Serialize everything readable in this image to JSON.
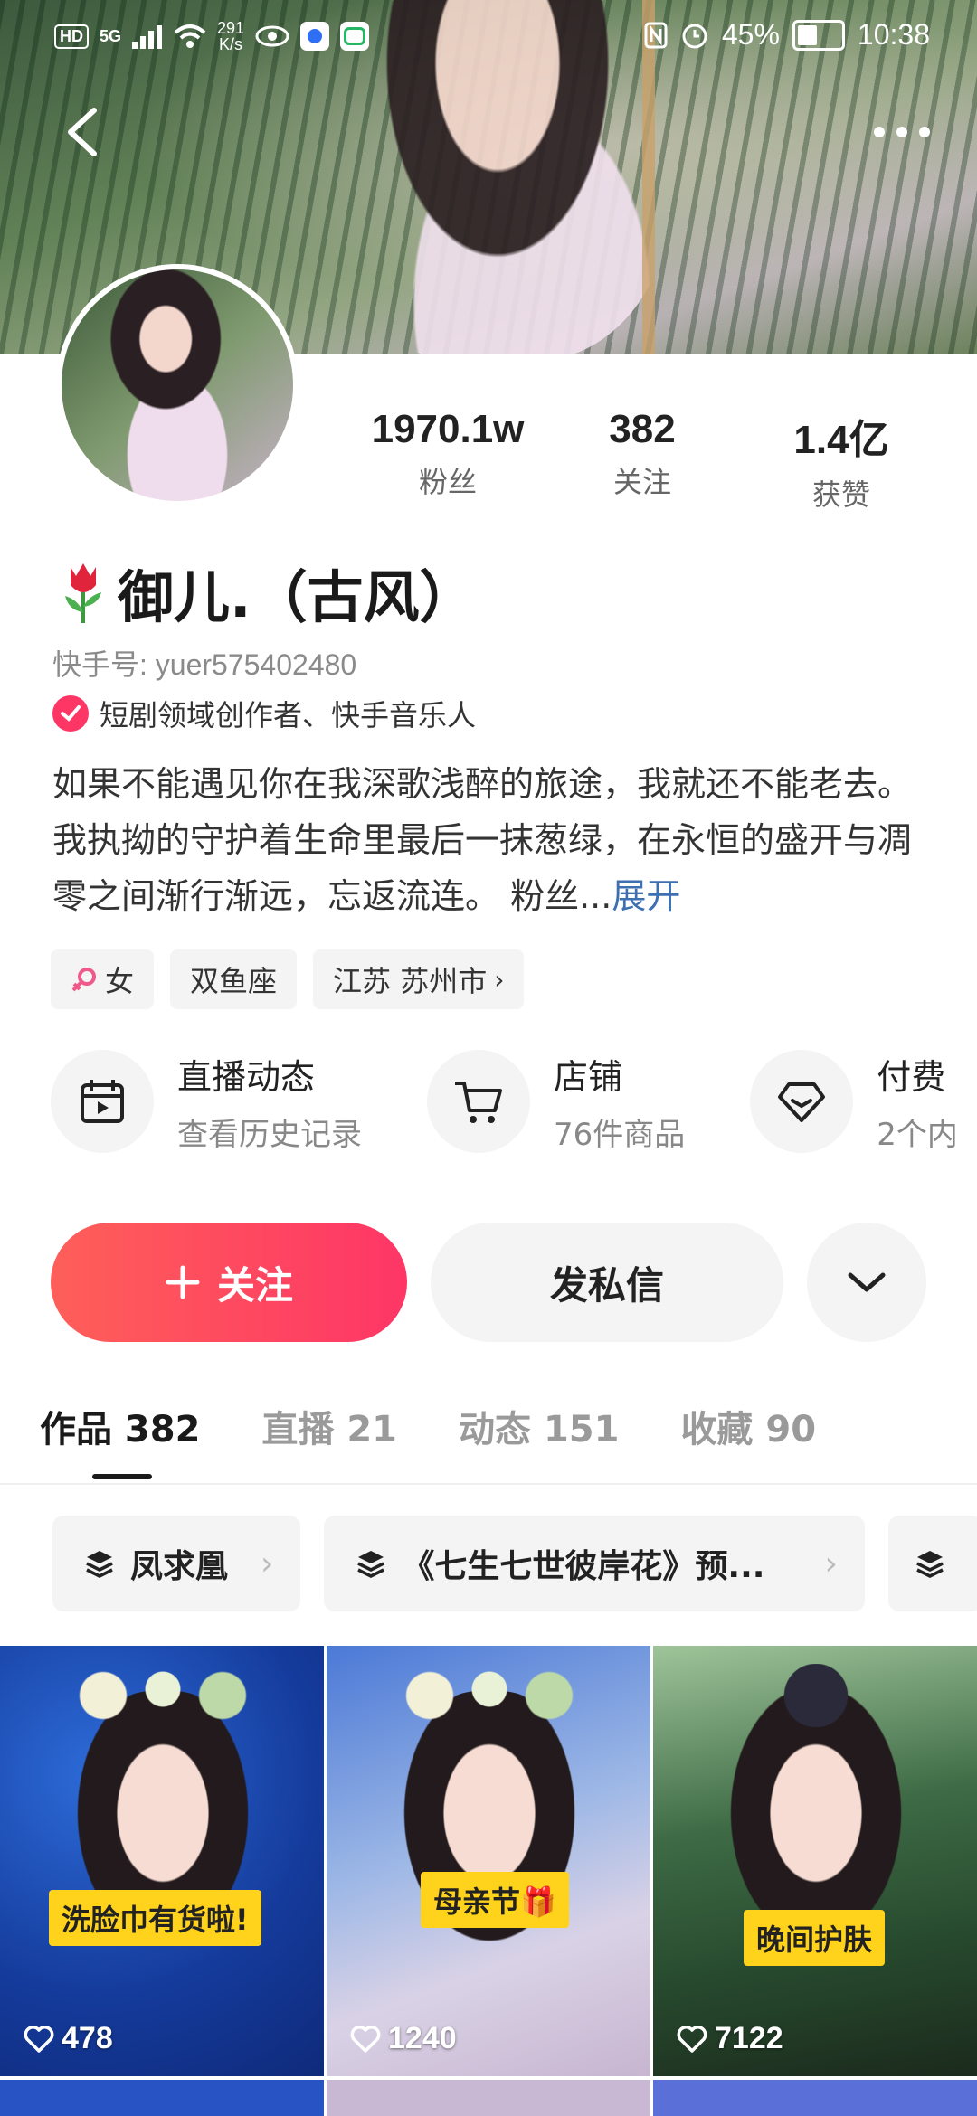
{
  "status_bar": {
    "hd": "HD",
    "signal": "5G",
    "net_speed_top": "291",
    "net_speed_bottom": "K/s",
    "battery": "45%",
    "time": "10:38"
  },
  "stats": [
    {
      "value": "1970.1w",
      "label": "粉丝"
    },
    {
      "value": "382",
      "label": "关注"
    },
    {
      "value": "1.4亿",
      "label": "获赞"
    }
  ],
  "profile": {
    "name": "御儿.（古风）",
    "user_id": "快手号: yuer575402480",
    "certification": "短剧领域创作者、快手音乐人",
    "bio": "如果不能遇见你在我深歌浅醉的旅途，我就还不能老去。 我执拗的守护着生命里最后一抹葱绿，在永恒的盛开与凋零之间渐行渐远，忘返流连。 粉丝...",
    "bio_more": "展开",
    "tags": [
      "女",
      "双鱼座",
      "江苏 苏州市"
    ]
  },
  "services": [
    {
      "title": "直播动态",
      "subtitle": "查看历史记录",
      "icon": "calendar-play-icon"
    },
    {
      "title": "店铺",
      "subtitle": "76件商品",
      "icon": "cart-icon"
    },
    {
      "title": "付费",
      "subtitle": "2个内",
      "icon": "diamond-icon"
    }
  ],
  "actions": {
    "follow": "关注",
    "message": "发私信"
  },
  "tabs": [
    {
      "label": "作品 382",
      "active": true
    },
    {
      "label": "直播 21",
      "active": false
    },
    {
      "label": "动态 151",
      "active": false
    },
    {
      "label": "收藏 90",
      "active": false
    }
  ],
  "collections": [
    {
      "label": "凤求凰"
    },
    {
      "label": "《七生七世彼岸花》预..."
    }
  ],
  "videos": [
    {
      "caption": "洗脸巾有货啦!",
      "likes": "478"
    },
    {
      "caption": "母亲节🎁",
      "likes": "1240"
    },
    {
      "caption": "晚间护肤",
      "likes": "7122"
    }
  ],
  "colors": {
    "accent": "#fe3666",
    "link": "#3e6fb0",
    "caption_bg": "#ffd21c"
  }
}
